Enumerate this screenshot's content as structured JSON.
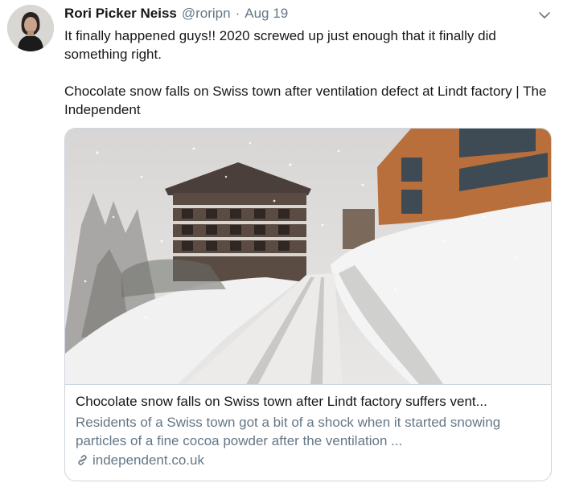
{
  "tweet": {
    "author_name": "Rori Picker Neiss",
    "author_handle": "@roripn",
    "separator": "·",
    "date": "Aug 19",
    "text_line1": "It finally happened guys!! 2020 screwed up just enough that it finally did something right.",
    "text_line2": "Chocolate snow falls on Swiss town after ventilation defect at Lindt factory | The Independent"
  },
  "card": {
    "title": "Chocolate snow falls on Swiss town after Lindt factory suffers vent...",
    "description": "Residents of a Swiss town got a bit of a shock when it started snowing particles of a fine cocoa powder after the ventilation ...",
    "domain": "independent.co.uk"
  },
  "icons": {
    "menu": "chevron-down-icon",
    "link": "link-icon"
  },
  "colors": {
    "text": "#14171a",
    "secondary": "#657786",
    "border": "#ccd6dd"
  }
}
